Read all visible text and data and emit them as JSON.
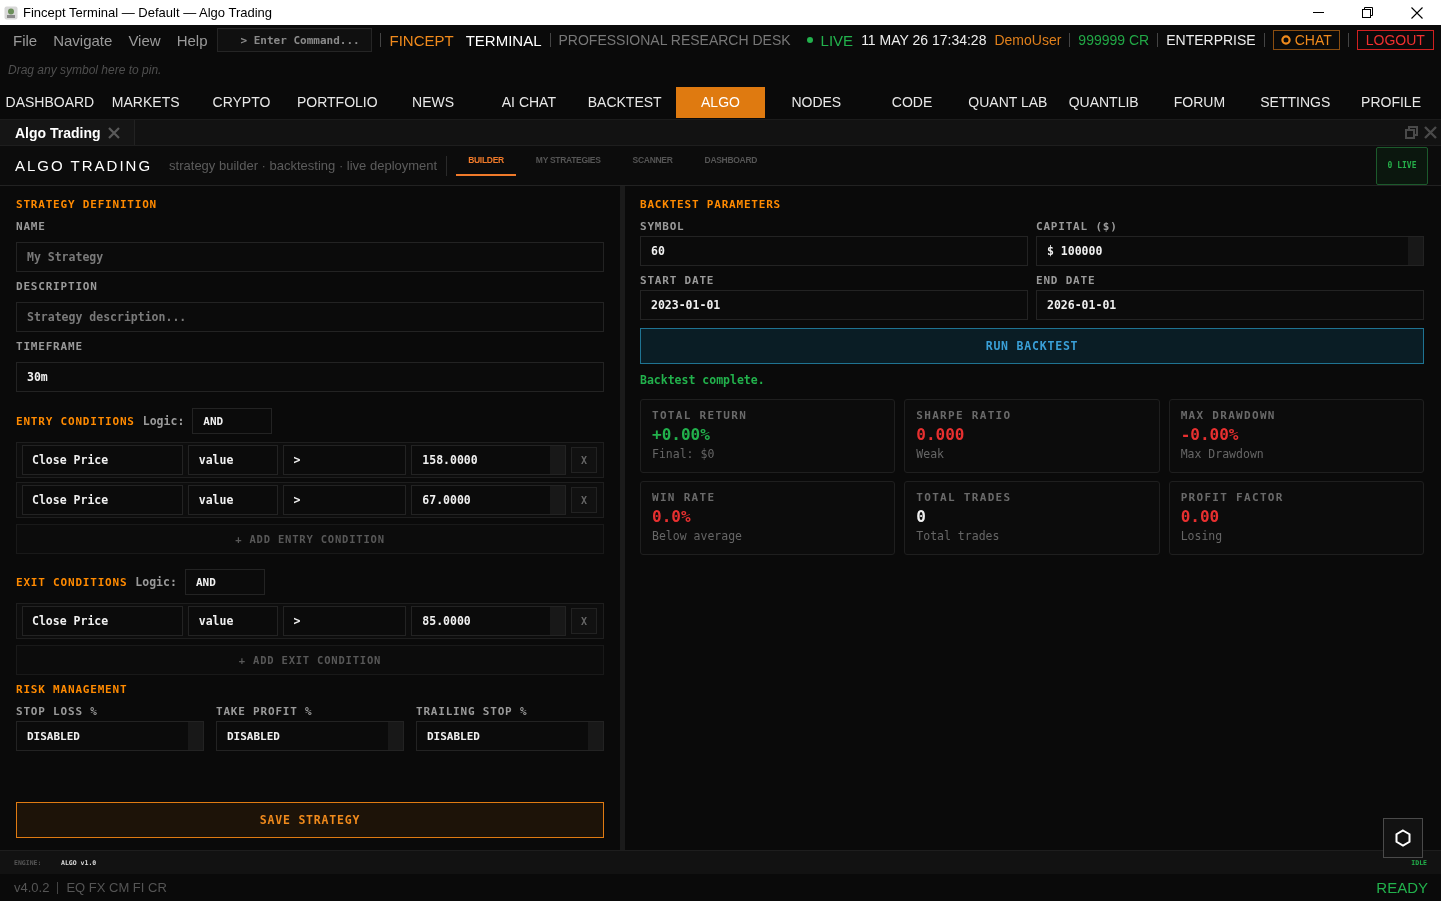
{
  "window": {
    "title": "Fincept Terminal — Default — Algo Trading"
  },
  "menu_bar": {
    "menus": [
      "File",
      "Navigate",
      "View",
      "Help"
    ],
    "command": {
      "placeholder": "> Enter Command..."
    },
    "brand": {
      "name": "FINCEPT",
      "product": "TERMINAL",
      "tagline": "PROFESSIONAL RESEARCH DESK"
    },
    "status": {
      "live": true,
      "live_label": "LIVE",
      "datetime": "11 MAY 26 17:34:28",
      "user": "DemoUser",
      "credits": "999999 CR",
      "plan": "ENTERPRISE"
    },
    "actions": [
      {
        "kind": "chat",
        "label": "CHAT"
      },
      {
        "kind": "logout",
        "label": "LOGOUT"
      }
    ]
  },
  "pin_bar": {
    "hint": "Drag any symbol here to pin."
  },
  "nav_tabs": [
    {
      "label": "DASHBOARD",
      "selected": false
    },
    {
      "label": "MARKETS",
      "selected": false
    },
    {
      "label": "CRYPTO",
      "selected": false
    },
    {
      "label": "PORTFOLIO",
      "selected": false
    },
    {
      "label": "NEWS",
      "selected": false
    },
    {
      "label": "AI CHAT",
      "selected": false
    },
    {
      "label": "BACKTEST",
      "selected": false
    },
    {
      "label": "ALGO",
      "selected": true
    },
    {
      "label": "NODES",
      "selected": false
    },
    {
      "label": "CODE",
      "selected": false
    },
    {
      "label": "QUANT LAB",
      "selected": false
    },
    {
      "label": "QUANTLIB",
      "selected": false
    },
    {
      "label": "FORUM",
      "selected": false
    },
    {
      "label": "SETTINGS",
      "selected": false
    },
    {
      "label": "PROFILE",
      "selected": false
    }
  ],
  "panel_tabs": [
    {
      "label": "Algo Trading"
    }
  ],
  "header": {
    "title": "ALGO TRADING",
    "subtitle": "strategy builder · backtesting · live deployment",
    "tabs": [
      {
        "label": "BUILDER",
        "selected": true
      },
      {
        "label": "MY STRATEGIES",
        "selected": false
      },
      {
        "label": "SCANNER",
        "selected": false
      },
      {
        "label": "DASHBOARD",
        "selected": false
      }
    ],
    "live_count": "0 LIVE"
  },
  "strategy": {
    "title": "STRATEGY DEFINITION",
    "fields": [
      {
        "label": "NAME",
        "placeholder": "My Strategy"
      },
      {
        "label": "DESCRIPTION",
        "placeholder": "Strategy description..."
      },
      {
        "label": "TIMEFRAME",
        "value": "30m"
      }
    ]
  },
  "condition_groups": [
    {
      "title": "ENTRY CONDITIONS",
      "logic_label": "Logic:",
      "logic": "AND",
      "rows": [
        {
          "indicator": "Close Price",
          "source": "value",
          "operator": ">",
          "threshold": "158.0000",
          "remove": "X"
        },
        {
          "indicator": "Close Price",
          "source": "value",
          "operator": ">",
          "threshold": "67.0000",
          "remove": "X"
        }
      ],
      "add_label": "+ ADD ENTRY CONDITION"
    },
    {
      "title": "EXIT CONDITIONS",
      "logic_label": "Logic:",
      "logic": "AND",
      "rows": [
        {
          "indicator": "Close Price",
          "source": "value",
          "operator": ">",
          "threshold": "85.0000",
          "remove": "X"
        }
      ],
      "add_label": "+ ADD EXIT CONDITION"
    }
  ],
  "risk": {
    "title": "RISK MANAGEMENT",
    "fields": [
      {
        "label": "STOP LOSS %",
        "value": "DISABLED"
      },
      {
        "label": "TAKE PROFIT %",
        "value": "DISABLED"
      },
      {
        "label": "TRAILING STOP %",
        "value": "DISABLED"
      }
    ]
  },
  "save_label": "SAVE STRATEGY",
  "backtest": {
    "title": "BACKTEST PARAMETERS",
    "fields": [
      {
        "label": "SYMBOL",
        "value": "60",
        "kind": "text"
      },
      {
        "label": "CAPITAL ($)",
        "value": "$ 100000",
        "kind": "number"
      },
      {
        "label": "START DATE",
        "value": "2023-01-01",
        "kind": "text"
      },
      {
        "label": "END DATE",
        "value": "2026-01-01",
        "kind": "text"
      }
    ],
    "run_label": "RUN BACKTEST",
    "status": "Backtest complete."
  },
  "metrics": [
    {
      "label": "TOTAL RETURN",
      "value": "+0.00%",
      "note": "Final: $0",
      "color": "#22b14c"
    },
    {
      "label": "SHARPE RATIO",
      "value": "0.000",
      "note": "Weak",
      "color": "#e83030"
    },
    {
      "label": "MAX DRAWDOWN",
      "value": "-0.00%",
      "note": "Max Drawdown",
      "color": "#e83030"
    },
    {
      "label": "WIN RATE",
      "value": "0.0%",
      "note": "Below average",
      "color": "#e83030"
    },
    {
      "label": "TOTAL TRADES",
      "value": "0",
      "note": "Total trades",
      "color": "#f0f0f0"
    },
    {
      "label": "PROFIT FACTOR",
      "value": "0.00",
      "note": "Losing",
      "color": "#e83030"
    }
  ],
  "status_bar": {
    "engine_label": "ENGINE:",
    "engine": "ALGO v1.0",
    "state": "IDLE"
  },
  "footer": {
    "version": "v4.0.2",
    "markets": "EQ FX CM FI CR",
    "ready": "READY"
  }
}
